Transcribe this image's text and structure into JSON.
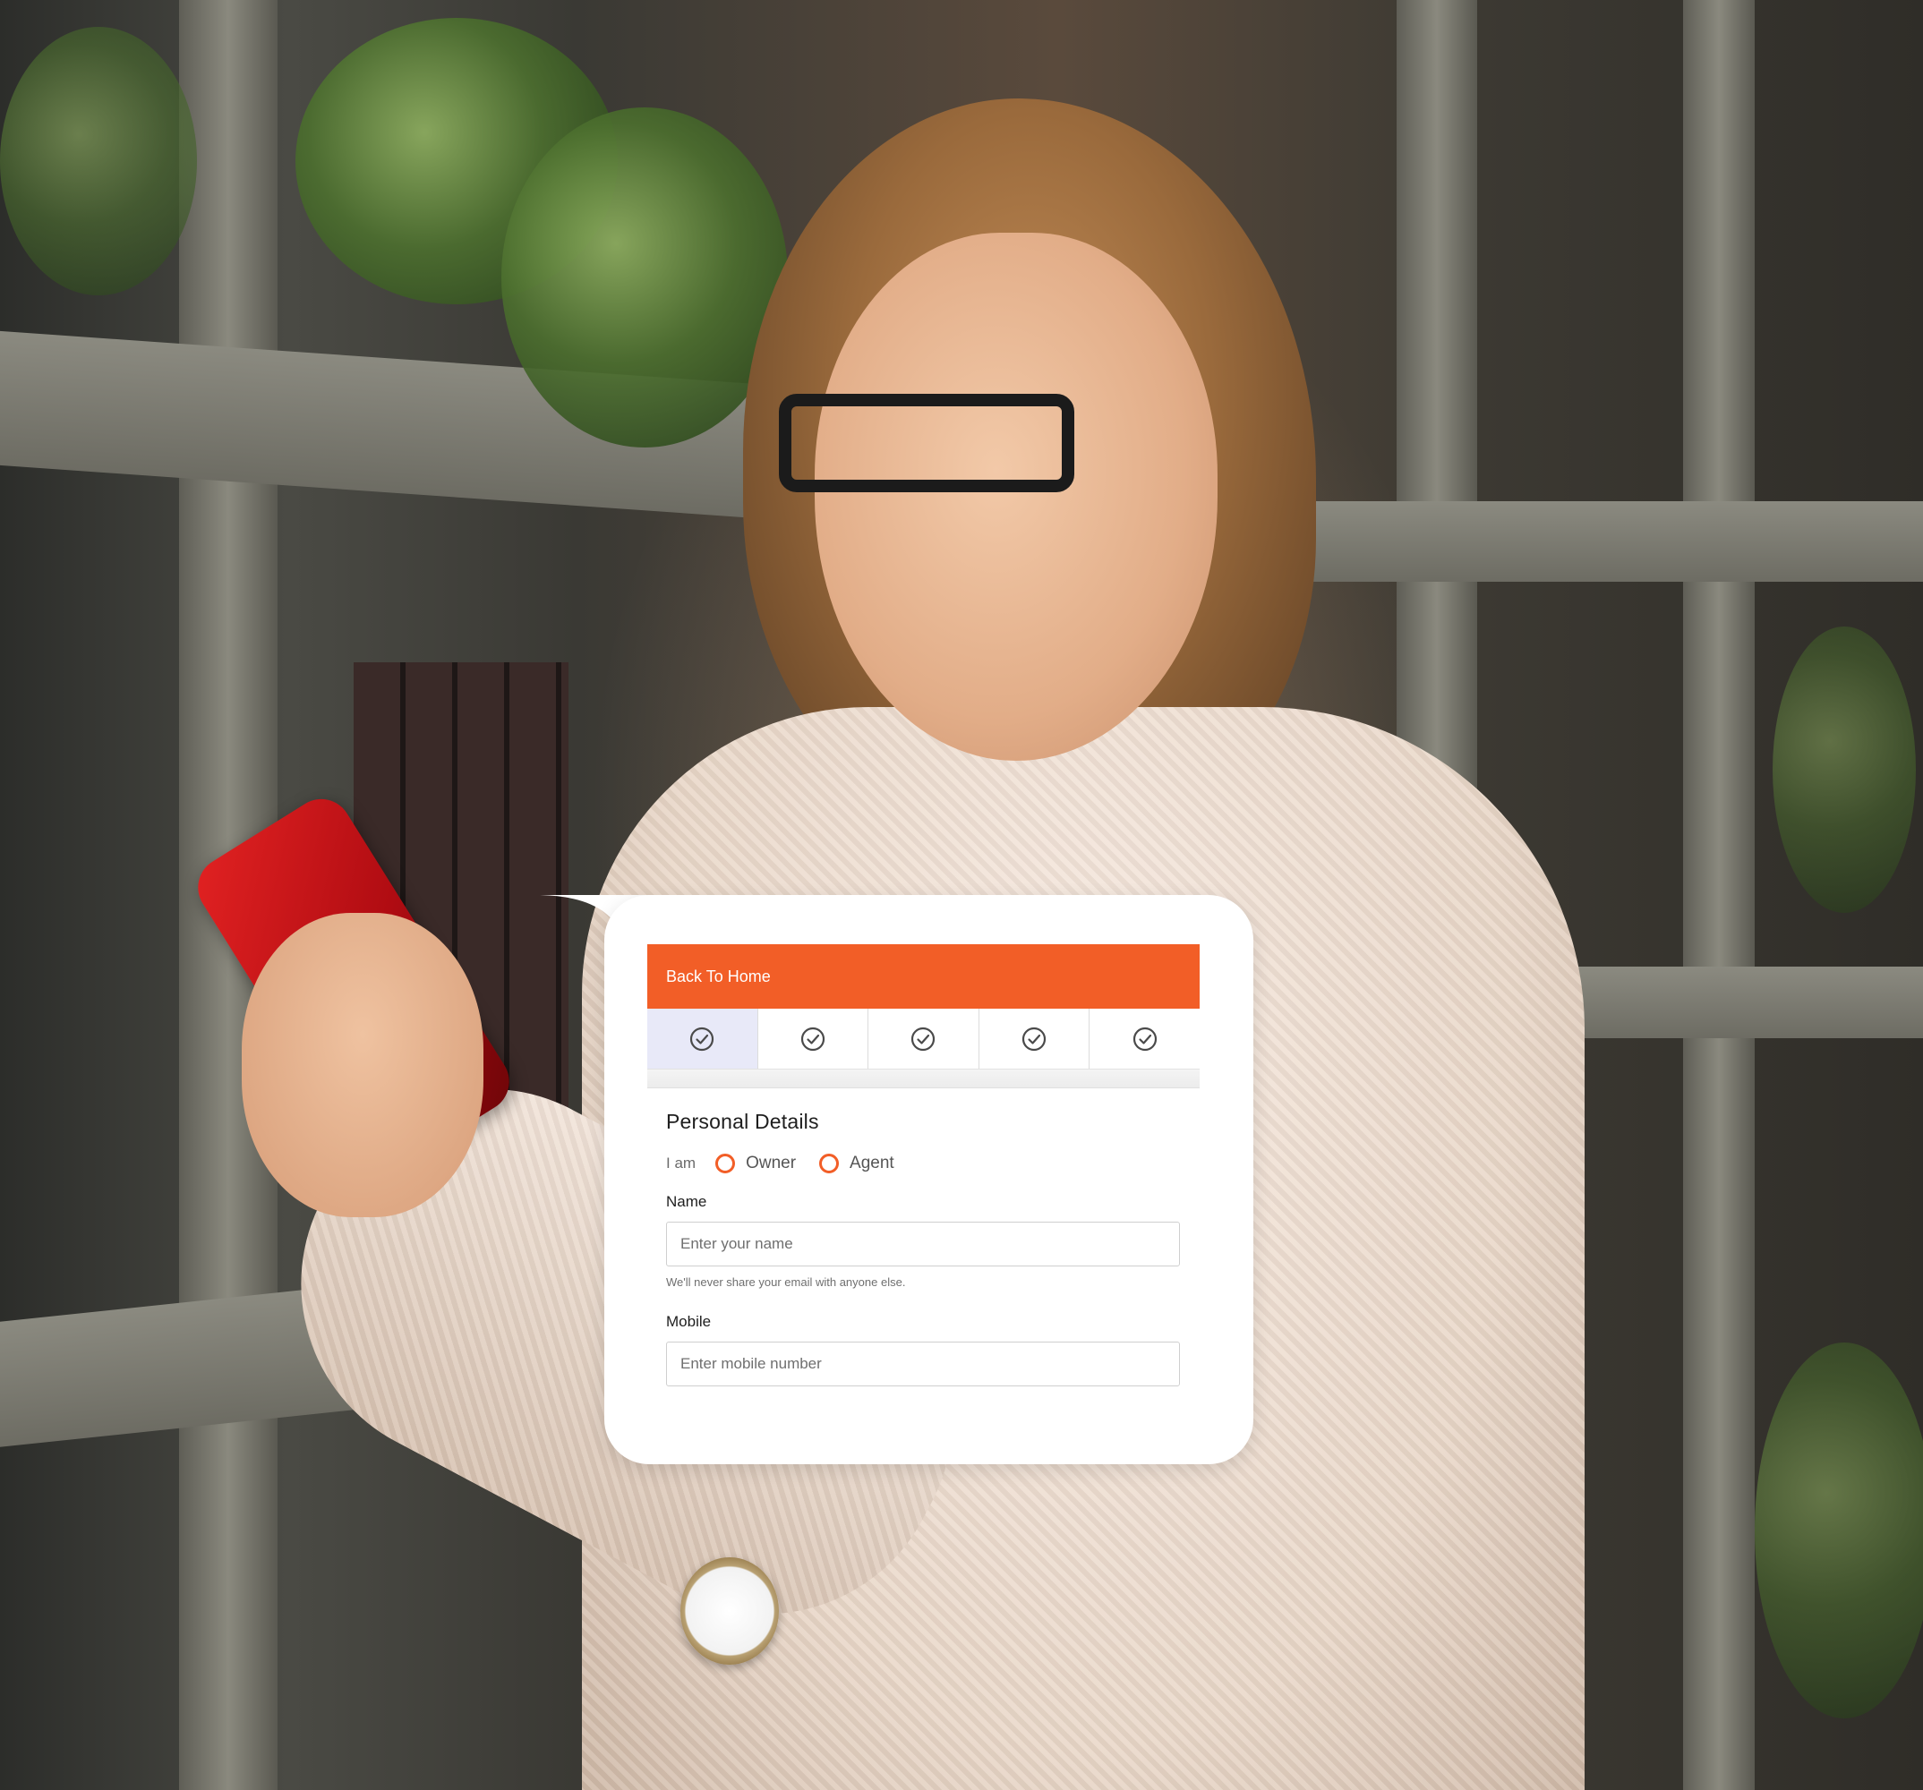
{
  "form": {
    "back_label": "Back To Home",
    "section_title": "Personal Details",
    "role_label": "I am",
    "role_options": [
      "Owner",
      "Agent"
    ],
    "name_label": "Name",
    "name_placeholder": "Enter your name",
    "name_help": "We'll never share your email with anyone else.",
    "mobile_label": "Mobile",
    "mobile_placeholder": "Enter mobile number"
  },
  "colors": {
    "accent": "#f25e27",
    "active_step_bg": "#e8e9f8"
  },
  "steps": [
    {
      "icon": "check-circle-icon",
      "active": true
    },
    {
      "icon": "check-circle-icon",
      "active": false
    },
    {
      "icon": "check-circle-icon",
      "active": false
    },
    {
      "icon": "check-circle-icon",
      "active": false
    },
    {
      "icon": "check-circle-icon",
      "active": false
    }
  ]
}
